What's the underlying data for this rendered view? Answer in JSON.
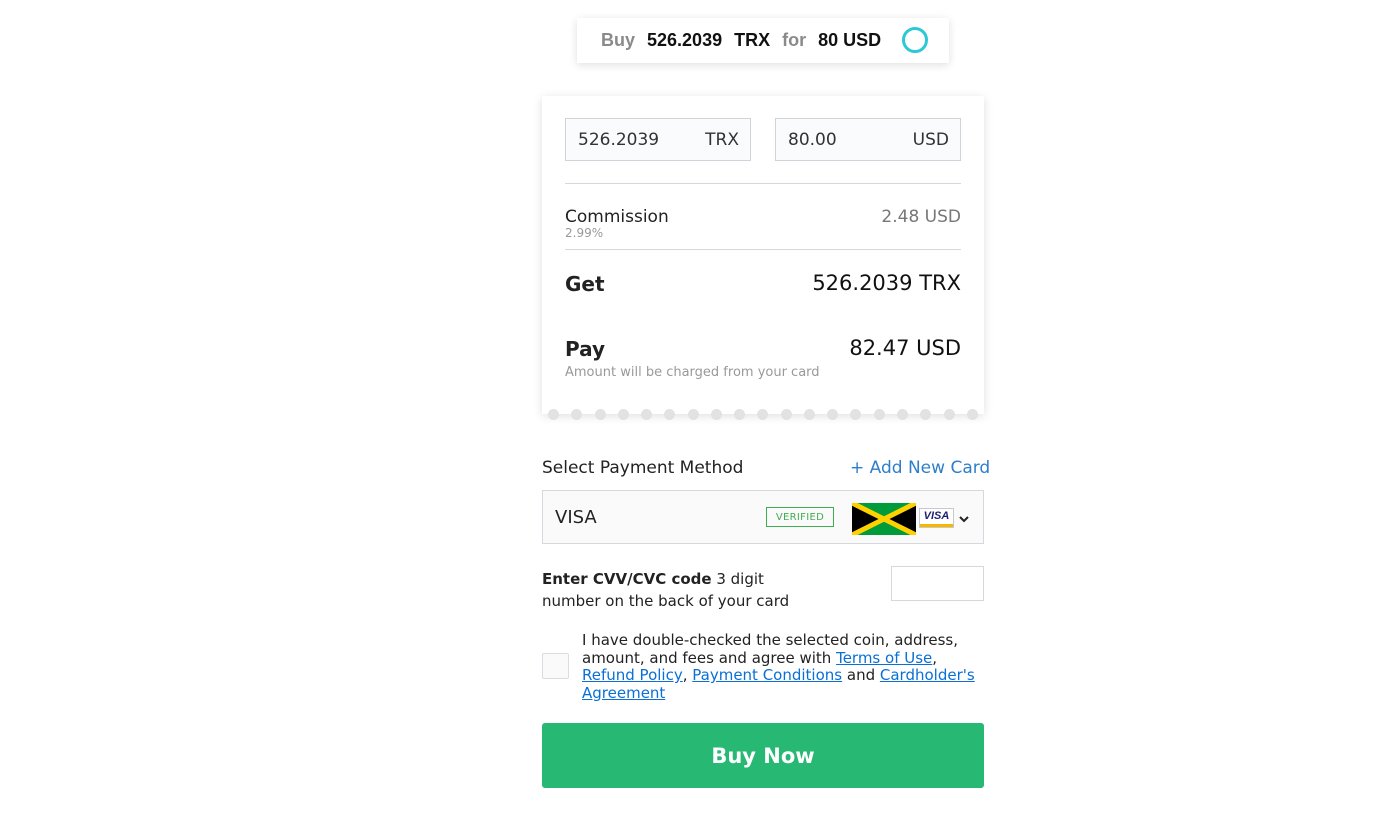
{
  "summary": {
    "buy_label": "Buy",
    "crypto_amount": "526.2039",
    "crypto_currency": "TRX",
    "for_label": "for",
    "fiat_amount": "80 USD",
    "spinner_color": "#2bc8d6"
  },
  "exchange": {
    "crypto_input_value": "526.2039",
    "crypto_input_currency": "TRX",
    "fiat_input_value": "80.00",
    "fiat_input_currency": "USD"
  },
  "commission": {
    "label": "Commission",
    "rate": "2.99%",
    "value": "2.48 USD"
  },
  "get": {
    "label": "Get",
    "value": "526.2039 TRX"
  },
  "pay": {
    "label": "Pay",
    "note": "Amount will be charged from your card",
    "value": "82.47 USD"
  },
  "payment_method": {
    "title": "Select Payment Method",
    "add_card_label": "+ Add New Card",
    "selected_card": {
      "brand_label": "VISA",
      "status_badge": "VERIFIED",
      "flag_icon": "jamaica-flag-icon",
      "network_logo_text": "VISA"
    }
  },
  "cvv": {
    "label_bold": "Enter CVV/CVC code",
    "label_rest": " 3 digit number on the back of your card",
    "input_value": "",
    "input_placeholder": ""
  },
  "agreement": {
    "text_start": "I have double-checked the selected coin, address, amount, and fees and agree with ",
    "terms_link": "Terms of Use",
    "comma": ",",
    "refund_link": "Refund Policy",
    "comma2": ", ",
    "payment_conditions_link": "Payment Conditions",
    "and_text": " and ",
    "cardholder_link": "Cardholder's Agreement",
    "checked": false
  },
  "buy_button": {
    "label": "Buy Now",
    "color": "#27b974"
  },
  "colors": {
    "link_blue": "#0a6fd6",
    "accent_blue": "#2e7ec9",
    "verified_green": "#3fae4f"
  }
}
